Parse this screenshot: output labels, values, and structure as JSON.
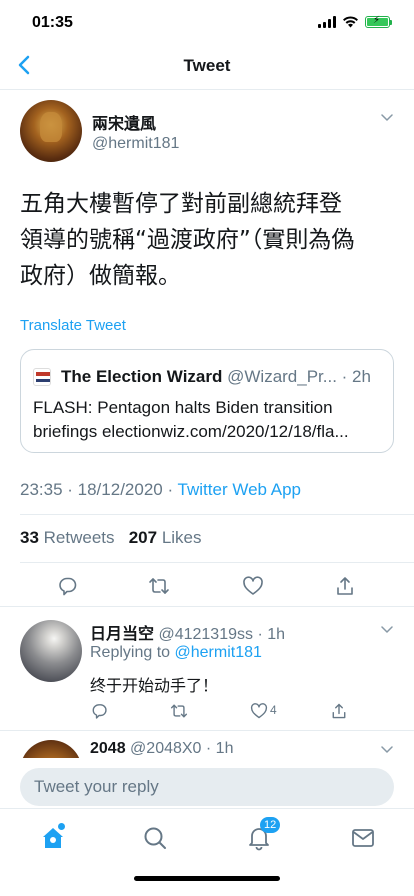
{
  "status": {
    "time": "01:35"
  },
  "nav": {
    "title": "Tweet"
  },
  "tweet": {
    "author_name": "兩宋遺風",
    "author_handle": "@hermit181",
    "text_lines": [
      "五角大樓暫停了對前副總統拜登",
      "領導的號稱“過渡政府”（實則為偽",
      "政府）做簡報。"
    ],
    "translate_label": "Translate Tweet",
    "quote": {
      "name": "The Election Wizard",
      "meta": "@Wizard_Pr... · 2h",
      "body_line1": "FLASH: Pentagon halts Biden transition",
      "body_line2": "briefings electionwiz.com/2020/12/18/fla..."
    },
    "timestamp": "23:35 · 18/12/2020 · ",
    "source": "Twitter Web App",
    "retweets_count": "33",
    "retweets_label": "Retweets",
    "likes_count": "207",
    "likes_label": "Likes"
  },
  "replies": [
    {
      "name": "日月当空",
      "meta": "@4121319ss · 1h",
      "replying_prefix": "Replying to ",
      "replying_to": "@hermit181",
      "text": "终于开始动手了！",
      "like_count": "4"
    },
    {
      "name": "2048",
      "meta": "@2048X0 · 1h"
    }
  ],
  "composer": {
    "placeholder": "Tweet your reply"
  },
  "tabs": {
    "notifications_badge": "12"
  },
  "colors": {
    "accent": "#1da1f2",
    "muted": "#657786",
    "border": "#e6ecf0"
  }
}
